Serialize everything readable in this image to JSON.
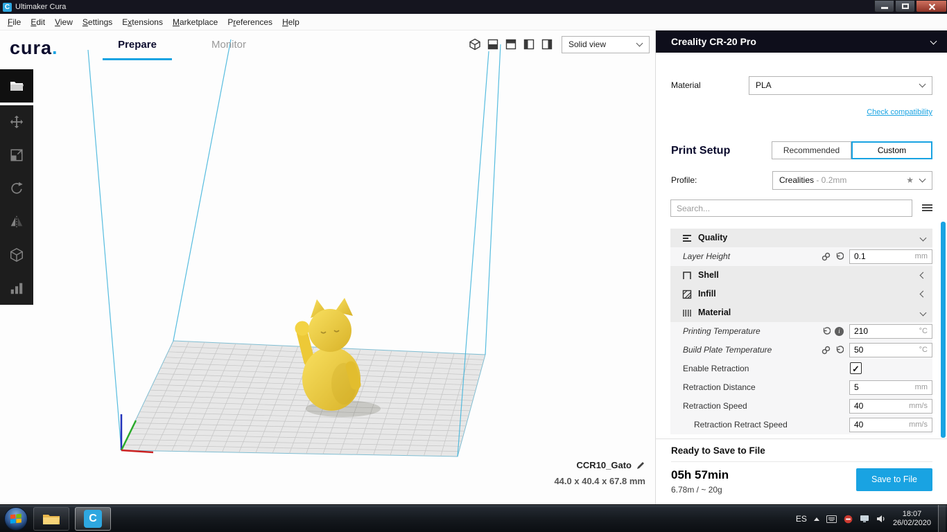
{
  "window": {
    "title": "Ultimaker Cura"
  },
  "icons": {
    "cura_letter": "C"
  },
  "menubar": {
    "items": [
      {
        "label": "File",
        "accel": 0
      },
      {
        "label": "Edit",
        "accel": 0
      },
      {
        "label": "View",
        "accel": 0
      },
      {
        "label": "Settings",
        "accel": 0
      },
      {
        "label": "Extensions",
        "accel": 1
      },
      {
        "label": "Marketplace",
        "accel": 0
      },
      {
        "label": "Preferences",
        "accel": 1
      },
      {
        "label": "Help",
        "accel": 0
      }
    ]
  },
  "header": {
    "logo_text": "cura",
    "logo_dot": ".",
    "tabs": {
      "prepare": "Prepare",
      "monitor": "Monitor"
    },
    "view_mode": "Solid view"
  },
  "machine": {
    "name": "Creality CR-20 Pro"
  },
  "material": {
    "label": "Material",
    "value": "PLA",
    "compatibility_link": "Check compatibility"
  },
  "print_setup": {
    "title": "Print Setup",
    "recommended_label": "Recommended",
    "custom_label": "Custom",
    "profile_label": "Profile:",
    "profile_name": "Crealities",
    "profile_detail": " - 0.2mm"
  },
  "settings": {
    "search_placeholder": "Search...",
    "rows": [
      {
        "kind": "category",
        "label": "Quality",
        "expanded": true
      },
      {
        "kind": "setting",
        "label": "Layer Height",
        "value": "0.1",
        "unit": "mm",
        "italic": true,
        "icons": [
          "link",
          "reset"
        ]
      },
      {
        "kind": "category",
        "label": "Shell",
        "expanded": false
      },
      {
        "kind": "category",
        "label": "Infill",
        "expanded": false
      },
      {
        "kind": "category",
        "label": "Material",
        "expanded": true
      },
      {
        "kind": "setting",
        "label": "Printing Temperature",
        "value": "210",
        "unit": "°C",
        "italic": true,
        "icons": [
          "reset",
          "info"
        ]
      },
      {
        "kind": "setting",
        "label": "Build Plate Temperature",
        "value": "50",
        "unit": "°C",
        "italic": true,
        "icons": [
          "link",
          "reset"
        ]
      },
      {
        "kind": "checkbox",
        "label": "Enable Retraction",
        "checked": true
      },
      {
        "kind": "setting",
        "label": "Retraction Distance",
        "value": "5",
        "unit": "mm"
      },
      {
        "kind": "setting",
        "label": "Retraction Speed",
        "value": "40",
        "unit": "mm/s"
      },
      {
        "kind": "setting",
        "label": "Retraction Retract Speed",
        "value": "40",
        "unit": "mm/s",
        "indent": true
      }
    ]
  },
  "model": {
    "name": "CCR10_Gato",
    "dimensions": "44.0 x 40.4 x 67.8 mm"
  },
  "job": {
    "status": "Ready to Save to File",
    "time": "05h 57min",
    "usage": "6.78m / ~ 20g",
    "save_label": "Save to File"
  },
  "taskbar": {
    "language": "ES",
    "time": "18:07",
    "date": "26/02/2020"
  },
  "colors": {
    "accent": "#19a3e2",
    "model_color": "#f0ce3a",
    "build_volume": "#45b6dc"
  }
}
